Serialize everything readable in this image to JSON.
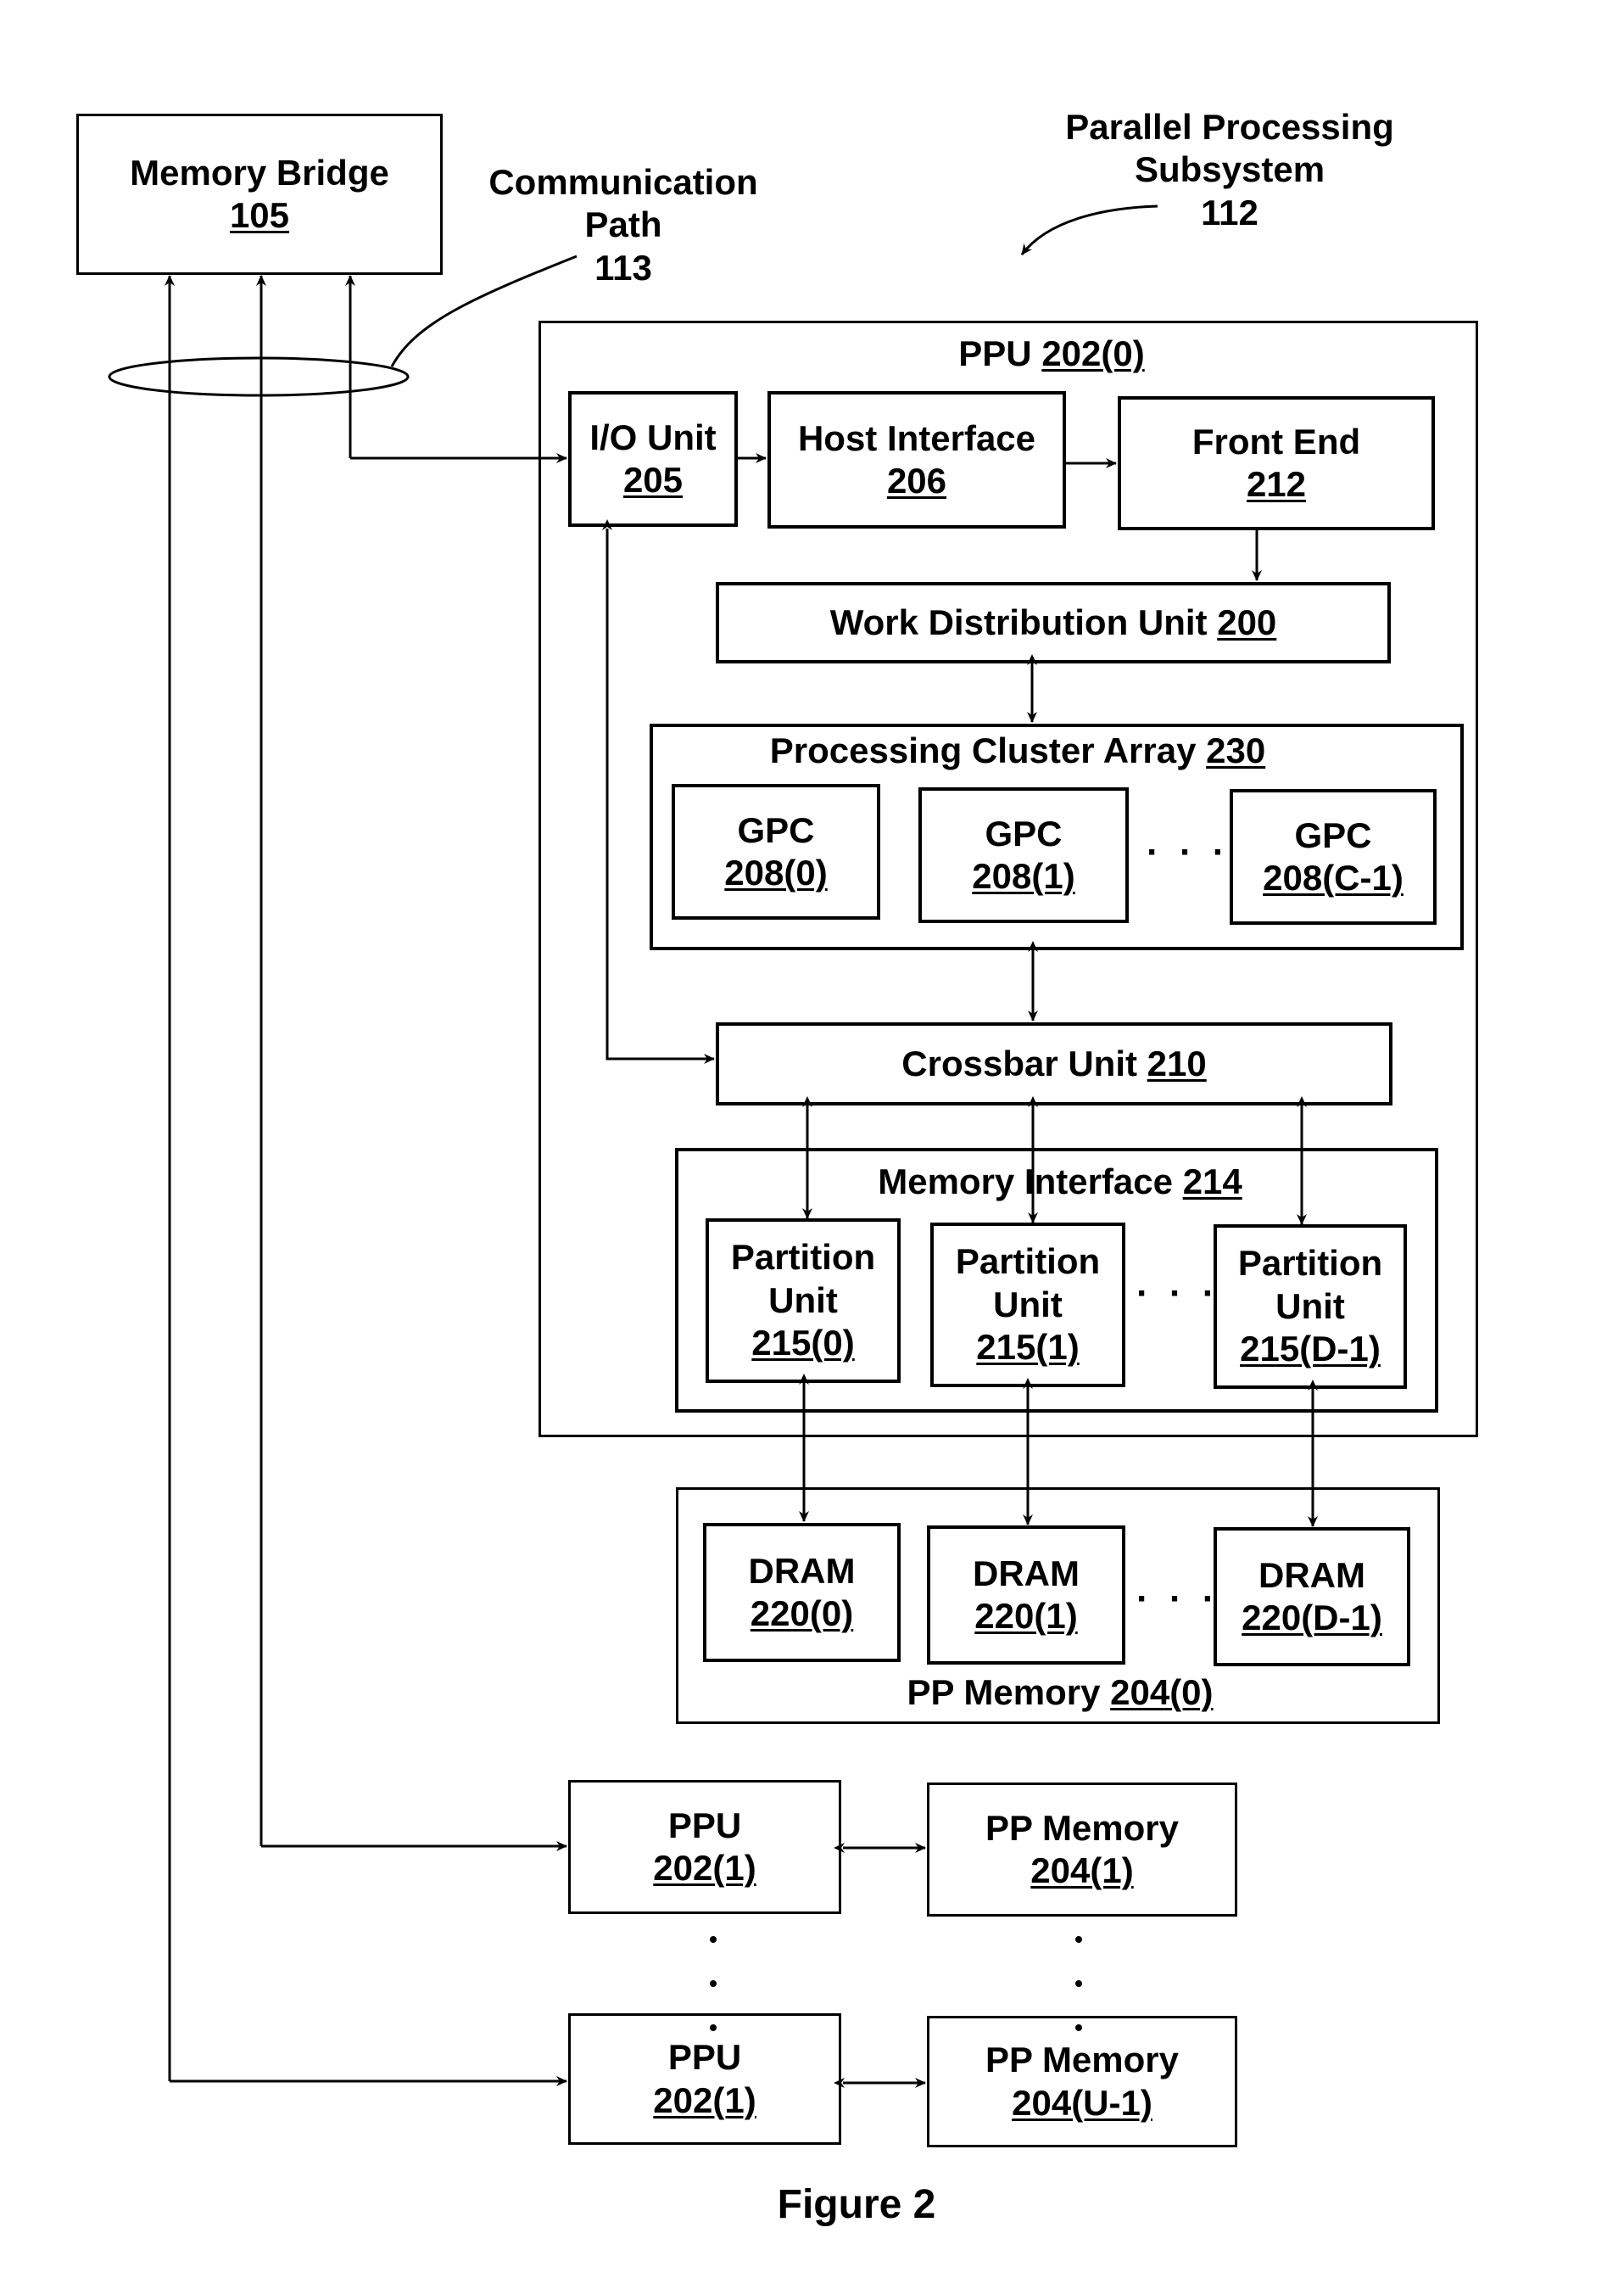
{
  "figure": {
    "caption": "Figure 2",
    "callouts": {
      "subsystem": {
        "line1": "Parallel Processing",
        "line2": "Subsystem",
        "ref": "112"
      },
      "comm_path": {
        "line1": "Communication",
        "line2": "Path",
        "ref": "113"
      }
    },
    "memory_bridge": {
      "name": "Memory Bridge",
      "ref": "105"
    },
    "ppu0": {
      "title": "PPU",
      "ref": "202(0)",
      "io_unit": {
        "name": "I/O Unit",
        "ref": "205"
      },
      "host_interface": {
        "name": "Host Interface",
        "ref": "206"
      },
      "front_end": {
        "name": "Front End",
        "ref": "212"
      },
      "work_distribution": {
        "name": "Work Distribution Unit",
        "ref": "200"
      },
      "pca": {
        "name": "Processing Cluster Array",
        "ref": "230",
        "gpcs": [
          {
            "name": "GPC",
            "ref": "208(0)"
          },
          {
            "name": "GPC",
            "ref": "208(1)"
          },
          {
            "name": "GPC",
            "ref": "208(C-1)"
          }
        ]
      },
      "crossbar": {
        "name": "Crossbar Unit",
        "ref": "210"
      },
      "memory_interface": {
        "name": "Memory Interface",
        "ref": "214",
        "partitions": [
          {
            "name1": "Partition",
            "name2": "Unit",
            "ref": "215(0)"
          },
          {
            "name1": "Partition",
            "name2": "Unit",
            "ref": "215(1)"
          },
          {
            "name1": "Partition",
            "name2": "Unit",
            "ref": "215(D-1)"
          }
        ]
      }
    },
    "pp_memory0": {
      "name": "PP Memory",
      "ref": "204(0)",
      "drams": [
        {
          "name": "DRAM",
          "ref": "220(0)"
        },
        {
          "name": "DRAM",
          "ref": "220(1)"
        },
        {
          "name": "DRAM",
          "ref": "220(D-1)"
        }
      ]
    },
    "ppu1": {
      "name": "PPU",
      "ref": "202(1)"
    },
    "pp_memory1": {
      "name": "PP Memory",
      "ref": "204(1)"
    },
    "ppu_last": {
      "name": "PPU",
      "ref": "202(1)"
    },
    "pp_memory_last": {
      "name": "PP Memory",
      "ref": "204(U-1)"
    },
    "ellipsis": "· · ·"
  }
}
